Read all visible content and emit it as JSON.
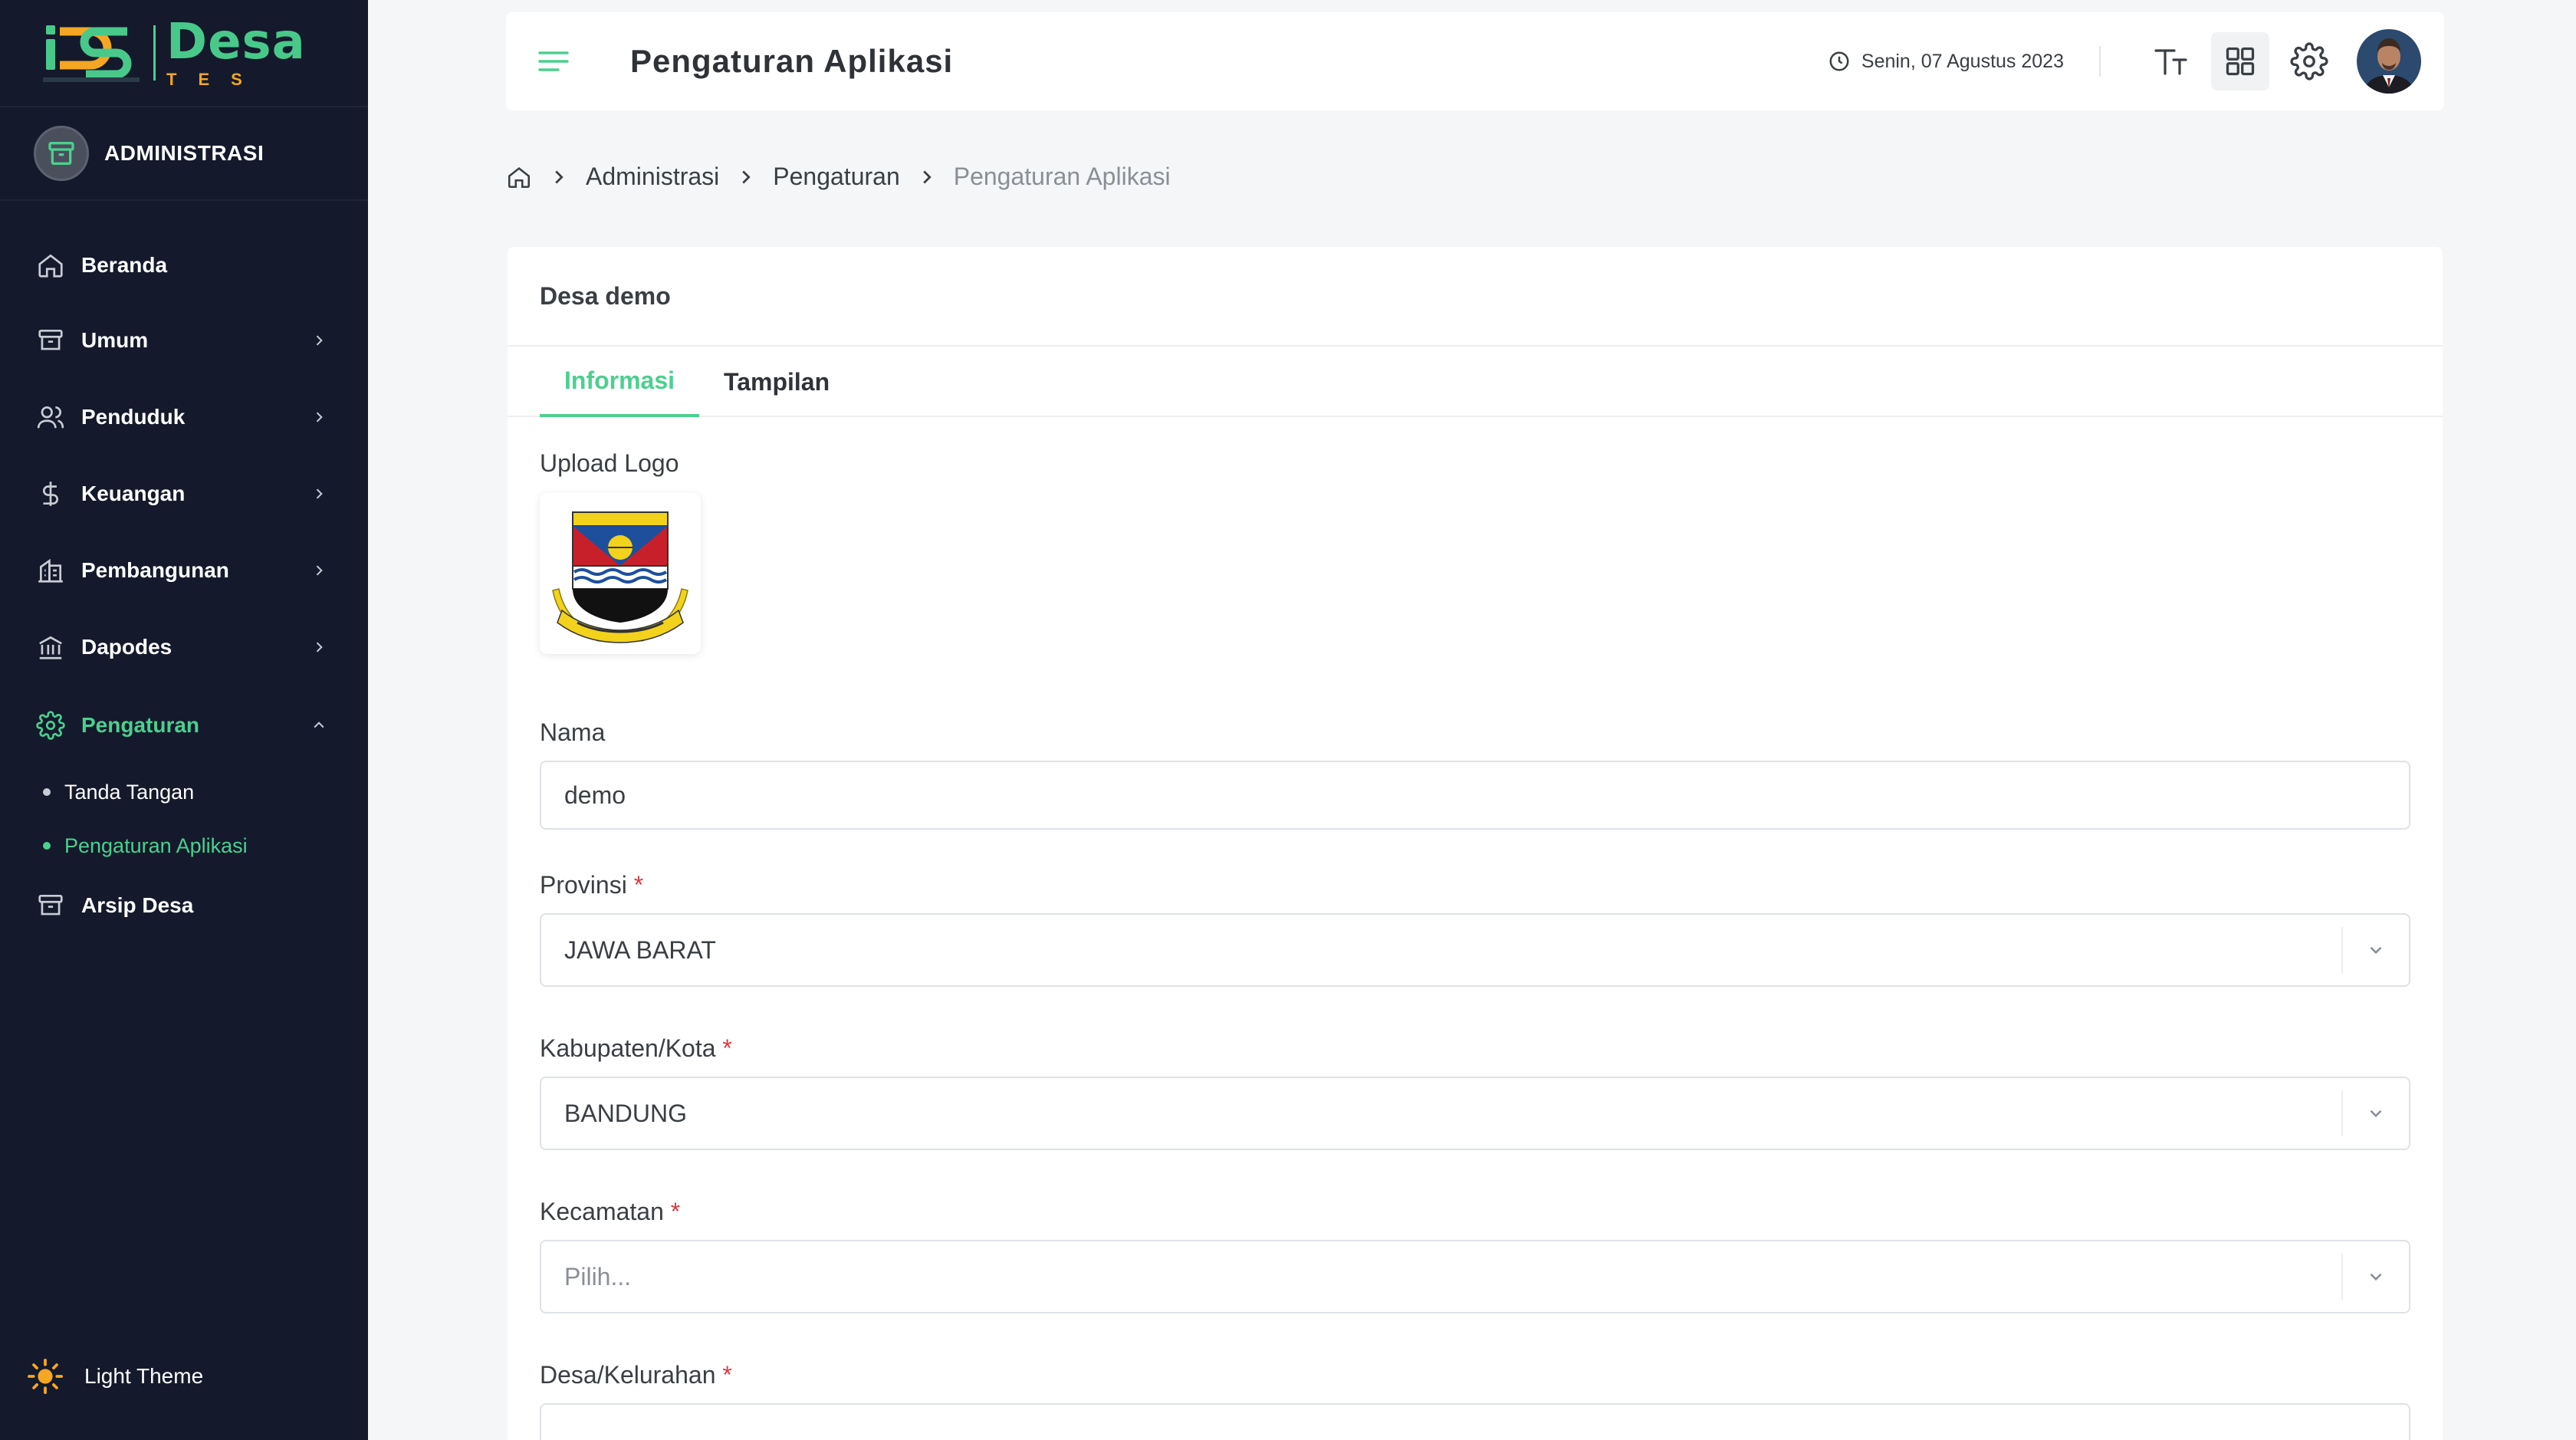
{
  "sidebar": {
    "logo_title": "Desa",
    "logo_sub": "TES",
    "role": "ADMINISTRASI",
    "items": [
      {
        "label": "Beranda"
      },
      {
        "label": "Umum"
      },
      {
        "label": "Penduduk"
      },
      {
        "label": "Keuangan"
      },
      {
        "label": "Pembangunan"
      },
      {
        "label": "Dapodes"
      },
      {
        "label": "Pengaturan"
      },
      {
        "label": "Arsip Desa"
      }
    ],
    "sub_items": [
      {
        "label": "Tanda Tangan"
      },
      {
        "label": "Pengaturan Aplikasi"
      }
    ],
    "theme_label": "Light Theme"
  },
  "header": {
    "title": "Pengaturan Aplikasi",
    "date": "Senin, 07 Agustus 2023"
  },
  "breadcrumb": [
    "Administrasi",
    "Pengaturan",
    "Pengaturan Aplikasi"
  ],
  "card": {
    "title": "Desa demo",
    "tabs": [
      "Informasi",
      "Tampilan"
    ],
    "active_tab": "Informasi"
  },
  "form": {
    "logo_label": "Upload Logo",
    "nama_label": "Nama",
    "nama_value": "demo",
    "provinsi_label": "Provinsi",
    "provinsi_value": "JAWA BARAT",
    "kabupaten_label": "Kabupaten/Kota",
    "kabupaten_value": "BANDUNG",
    "kecamatan_label": "Kecamatan",
    "kecamatan_placeholder": "Pilih...",
    "desa_label": "Desa/Kelurahan",
    "required_mark": "*"
  },
  "colors": {
    "accent": "#4bd08f",
    "sidebar_bg": "#141a2b",
    "required": "#e0383e"
  }
}
